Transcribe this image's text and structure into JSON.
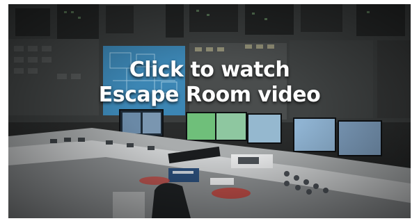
{
  "video_thumbnail": {
    "overlay_line1": "Click to watch",
    "overlay_line2": "Escape Room video",
    "scene_description_icon": "control-room-photo",
    "colors": {
      "text": "#ffffff",
      "panel_blue": "#3c86b4",
      "panel_green": "#6fbf7a",
      "desk": "#cfd1d2",
      "red_accent": "#c8423b"
    }
  }
}
